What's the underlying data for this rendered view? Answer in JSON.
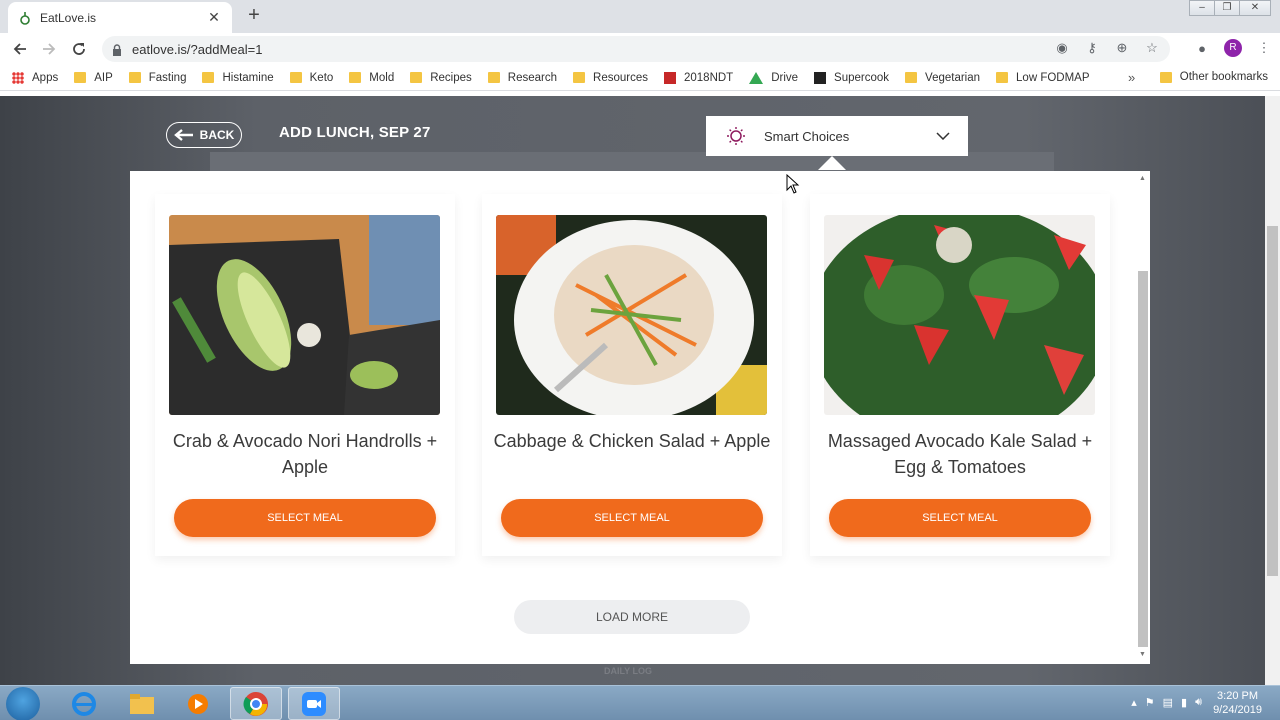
{
  "browser": {
    "tab_title": "EatLove.is",
    "url": "eatlove.is/?addMeal=1",
    "avatar_letter": "R",
    "bookmarks": [
      "Apps",
      "AIP",
      "Fasting",
      "Histamine",
      "Keto",
      "Mold",
      "Recipes",
      "Research",
      "Resources",
      "2018NDT",
      "Drive",
      "Supercook",
      "Vegetarian",
      "Low FODMAP"
    ],
    "other_bookmarks": "Other bookmarks"
  },
  "header": {
    "back_label": "BACK",
    "title": "ADD LUNCH, SEP 27",
    "filter_label": "Smart Choices"
  },
  "meals": [
    {
      "title": "Crab & Avocado Nori Handrolls + Apple",
      "button": "SELECT MEAL"
    },
    {
      "title": "Cabbage & Chicken Salad + Apple",
      "button": "SELECT MEAL"
    },
    {
      "title": "Massaged Avocado Kale Salad + Egg & Tomatoes",
      "button": "SELECT MEAL"
    }
  ],
  "load_more": "LOAD MORE",
  "footer_hint": "DAILY LOG",
  "taskbar": {
    "time": "3:20 PM",
    "date": "9/24/2019"
  },
  "colors": {
    "accent": "#f06a1c",
    "page_bg": "#5e6269"
  }
}
